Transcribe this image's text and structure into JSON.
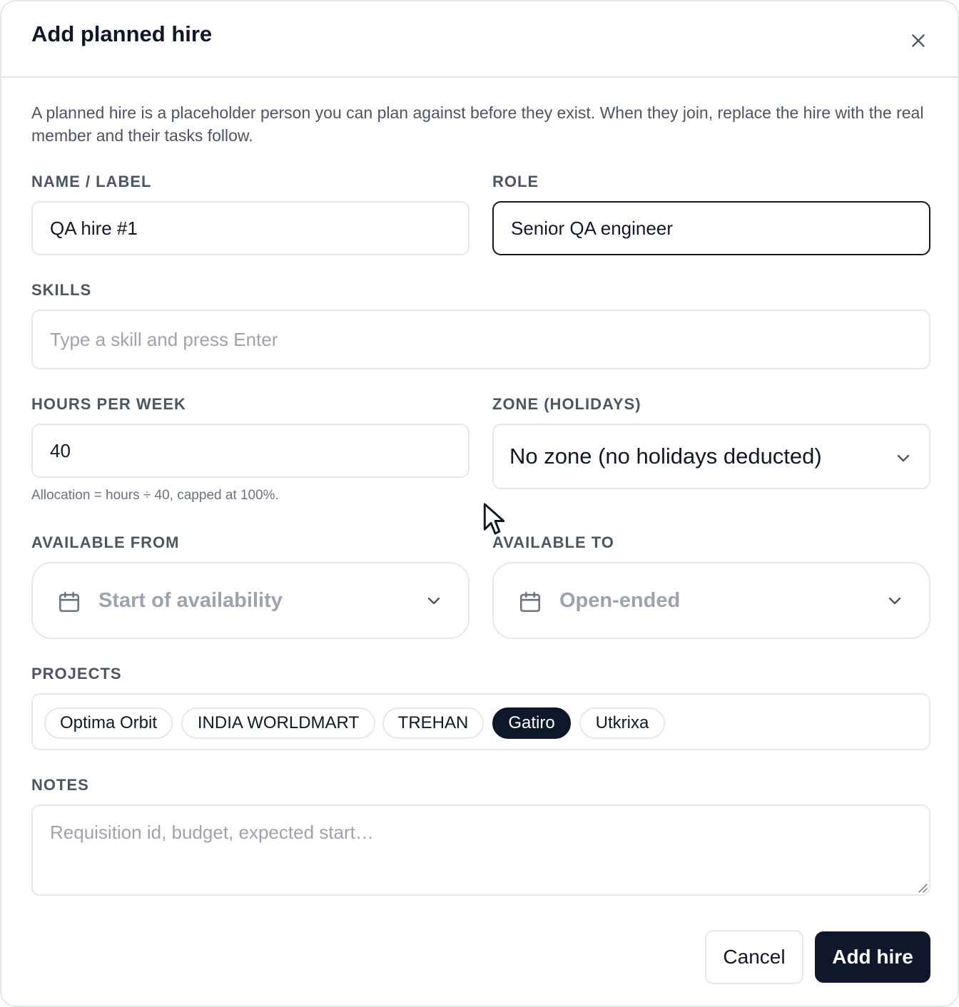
{
  "dialog": {
    "title": "Add planned hire",
    "close_icon": "close-icon",
    "intro": "A planned hire is a placeholder person you can plan against before they exist. When they join, replace the hire with the real member and their tasks follow."
  },
  "form": {
    "name": {
      "label": "NAME / LABEL",
      "value": "QA hire #1"
    },
    "role": {
      "label": "ROLE",
      "value": "Senior QA engineer"
    },
    "skills": {
      "label": "SKILLS",
      "placeholder": "Type a skill and press Enter"
    },
    "hours": {
      "label": "HOURS PER WEEK",
      "value": "40",
      "helper": "Allocation = hours ÷ 40, capped at 100%."
    },
    "zone": {
      "label": "ZONE (HOLIDAYS)",
      "value": "No zone (no holidays deducted)"
    },
    "available_from": {
      "label": "AVAILABLE FROM",
      "placeholder": "Start of availability",
      "icon": "calendar-icon"
    },
    "available_to": {
      "label": "AVAILABLE TO",
      "placeholder": "Open-ended",
      "icon": "calendar-icon"
    },
    "projects": {
      "label": "PROJECTS",
      "items": [
        {
          "label": "Optima Orbit",
          "selected": false
        },
        {
          "label": "INDIA WORLDMART",
          "selected": false
        },
        {
          "label": "TREHAN",
          "selected": false
        },
        {
          "label": "Gatiro",
          "selected": true
        },
        {
          "label": "Utkrixa",
          "selected": false
        }
      ]
    },
    "notes": {
      "label": "NOTES",
      "placeholder": "Requisition id, budget, expected start…"
    }
  },
  "actions": {
    "cancel_label": "Cancel",
    "submit_label": "Add hire"
  },
  "colors": {
    "primary": "#0f172a",
    "border": "#e5e7eb",
    "muted_text": "#4b5563",
    "placeholder": "#9ca3af"
  }
}
